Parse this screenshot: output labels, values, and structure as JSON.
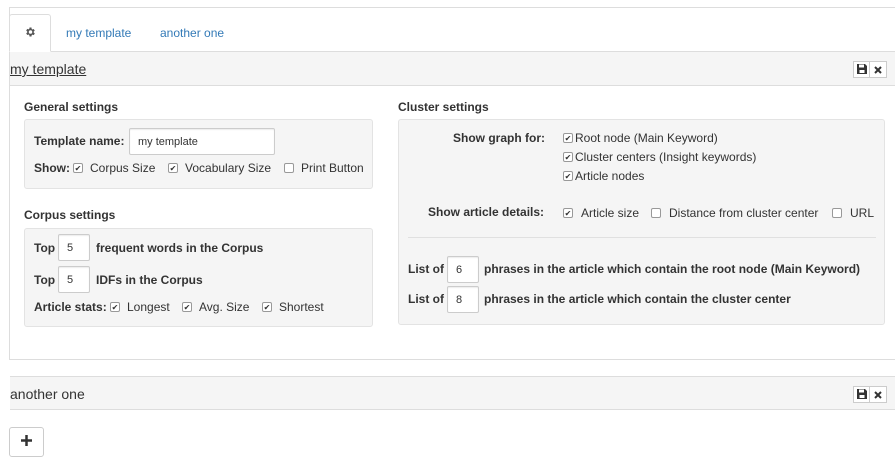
{
  "tabs": [
    {
      "label": "my template"
    },
    {
      "label": "another one"
    }
  ],
  "panel1": {
    "title": "my template",
    "general": {
      "heading": "General settings",
      "template_name_label": "Template name:",
      "template_name_value": "my template",
      "show_label": "Show:",
      "options": [
        {
          "label": "Corpus Size",
          "checked": true
        },
        {
          "label": "Vocabulary Size",
          "checked": true
        },
        {
          "label": "Print Button",
          "checked": false
        }
      ]
    },
    "corpus": {
      "heading": "Corpus settings",
      "top_label": "Top",
      "frequent_value": "5",
      "frequent_text": "frequent words in the Corpus",
      "idf_value": "5",
      "idf_text": "IDFs in the Corpus",
      "article_stats_label": "Article stats:",
      "stats": [
        {
          "label": "Longest",
          "checked": true
        },
        {
          "label": "Avg. Size",
          "checked": true
        },
        {
          "label": "Shortest",
          "checked": true
        }
      ]
    },
    "cluster": {
      "heading": "Cluster settings",
      "show_graph_label": "Show graph for:",
      "graph_options": [
        {
          "label": "Root node (Main Keyword)",
          "checked": true
        },
        {
          "label": "Cluster centers (Insight keywords)",
          "checked": true
        },
        {
          "label": "Article nodes",
          "checked": true
        }
      ],
      "article_details_label": "Show article details:",
      "details_options": [
        {
          "label": "Article size",
          "checked": true
        },
        {
          "label": "Distance from cluster center",
          "checked": false
        },
        {
          "label": "URL",
          "checked": false
        }
      ],
      "list_of_label": "List of",
      "root_phrases_value": "6",
      "root_phrases_text": "phrases in the article which contain the root node (Main Keyword)",
      "center_phrases_value": "8",
      "center_phrases_text": "phrases in the article which contain the cluster center"
    }
  },
  "panel2": {
    "title": "another one"
  },
  "icons": {
    "gear": "gear-icon",
    "save": "floppy-disk-icon",
    "close": "close-icon",
    "add": "plus-icon"
  }
}
